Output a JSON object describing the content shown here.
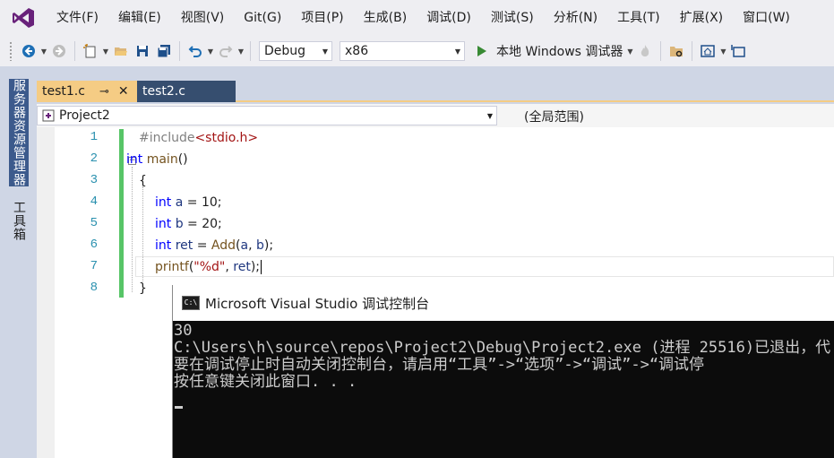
{
  "menu": {
    "items": [
      "文件(F)",
      "编辑(E)",
      "视图(V)",
      "Git(G)",
      "项目(P)",
      "生成(B)",
      "调试(D)",
      "测试(S)",
      "分析(N)",
      "工具(T)",
      "扩展(X)",
      "窗口(W)"
    ]
  },
  "toolbar": {
    "config": "Debug",
    "platform": "x86",
    "run_label": "本地 Windows 调试器"
  },
  "side_tabs": {
    "server_explorer": "服务器资源管理器",
    "toolbox": "工具箱"
  },
  "tabs": {
    "active": "test1.c",
    "active_pin": "⊸",
    "active_close": "✕",
    "inactive": "test2.c"
  },
  "nav": {
    "project": "Project2",
    "scope": "(全局范围)"
  },
  "editor": {
    "line_numbers": [
      "1",
      "2",
      "3",
      "4",
      "5",
      "6",
      "7",
      "8"
    ]
  },
  "console": {
    "title": "Microsoft Visual Studio 调试控制台",
    "icon_text": "C:\\",
    "lines": [
      "30",
      "C:\\Users\\h\\source\\repos\\Project2\\Debug\\Project2.exe (进程 25516)已退出，代",
      "要在调试停止时自动关闭控制台，请启用“工具”->“选项”->“调试”->“调试停",
      "按任意键关闭此窗口. . ."
    ]
  }
}
